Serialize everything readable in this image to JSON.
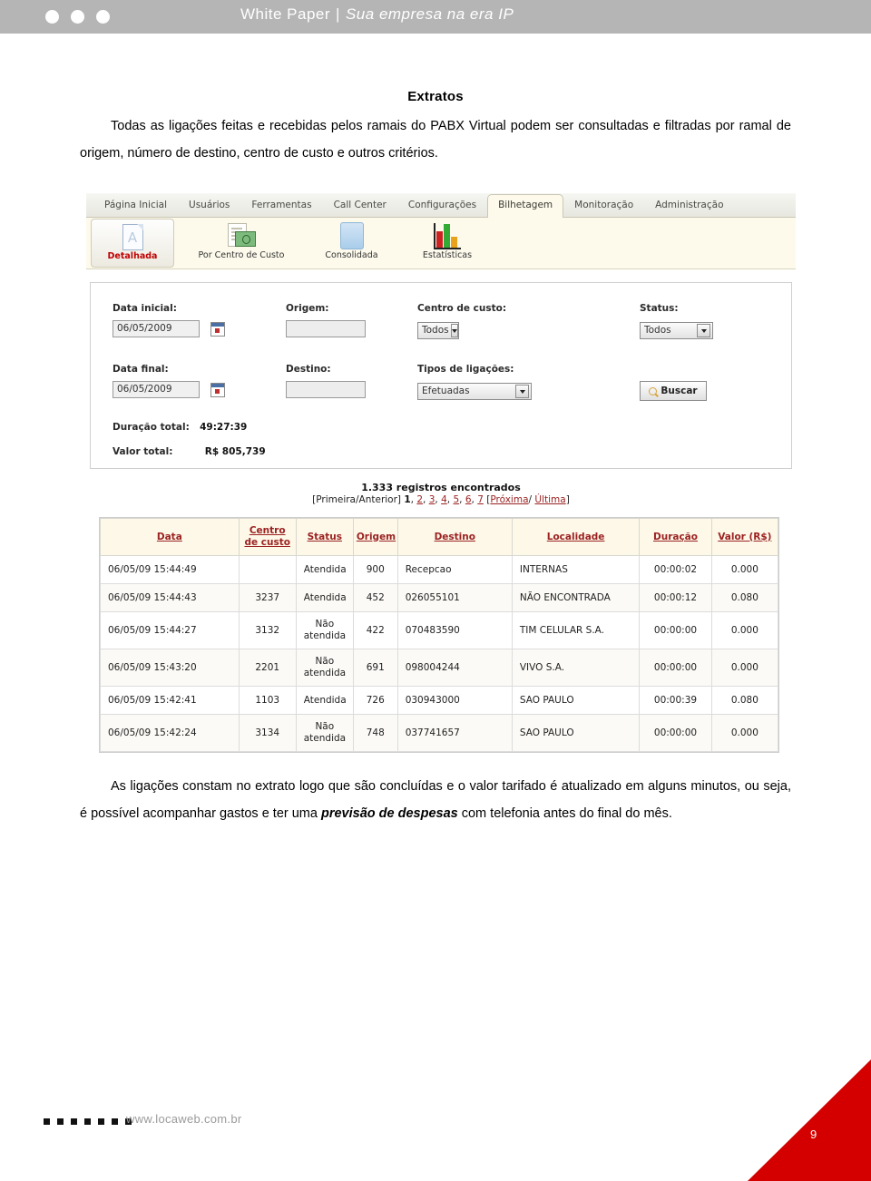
{
  "banner": {
    "dots": 3,
    "title_main": "White Paper",
    "separator": "|",
    "title_italic": "Sua empresa na era IP",
    "bg_color": "#b5b5b5"
  },
  "document": {
    "heading": "Extratos",
    "intro_paragraph": "Todas as ligações feitas e recebidas pelos ramais do PABX Virtual podem ser consultadas e filtradas por ramal de origem, número de destino, centro de custo e outros critérios.",
    "closing_paragraph_part1": "As ligações constam no extrato logo que são concluídas e o valor tarifado é atualizado em alguns minutos, ou seja, é possível acompanhar gastos e ter uma ",
    "closing_paragraph_bold": "previsão de despesas",
    "closing_paragraph_part2": " com telefonia antes do final do mês."
  },
  "app": {
    "tabs": [
      {
        "label": "Página Inicial",
        "active": false
      },
      {
        "label": "Usuários",
        "active": false
      },
      {
        "label": "Ferramentas",
        "active": false
      },
      {
        "label": "Call Center",
        "active": false
      },
      {
        "label": "Configurações",
        "active": false
      },
      {
        "label": "Bilhetagem",
        "active": true
      },
      {
        "label": "Monitoração",
        "active": false
      },
      {
        "label": "Administração",
        "active": false
      }
    ],
    "toolbar": [
      {
        "label": "Detalhada",
        "icon": "document-page-icon",
        "selected": true
      },
      {
        "label": "Por Centro de Custo",
        "icon": "cost-center-icon",
        "selected": false
      },
      {
        "label": "Consolidada",
        "icon": "consolidated-sheet-icon",
        "selected": false
      },
      {
        "label": "Estatísticas",
        "icon": "bar-chart-icon",
        "selected": false
      }
    ],
    "filters": {
      "data_inicial_label": "Data inicial:",
      "data_inicial_value": "06/05/2009",
      "data_final_label": "Data final:",
      "data_final_value": "06/05/2009",
      "origem_label": "Origem:",
      "origem_value": "",
      "destino_label": "Destino:",
      "destino_value": "",
      "centro_custo_label": "Centro de custo:",
      "centro_custo_value": "Todos",
      "tipos_ligacoes_label": "Tipos de ligações:",
      "tipos_ligacoes_value": "Efetuadas",
      "status_label": "Status:",
      "status_value": "Todos",
      "buscar_label": "Buscar"
    },
    "totals": {
      "duracao_label": "Duração total:",
      "duracao_value": "49:27:39",
      "valor_label": "Valor total:",
      "valor_value": "R$ 805,739"
    },
    "results": {
      "count_text": "1.333 registros encontrados",
      "pager_first": "[Primeira/Anterior]",
      "pages": [
        "1",
        "2",
        "3",
        "4",
        "5",
        "6",
        "7"
      ],
      "current_page": "1",
      "pager_open_bracket": "[",
      "pager_next": "Próxima",
      "pager_slash": "/",
      "pager_last": "Última",
      "pager_close_bracket": "]"
    },
    "table": {
      "columns": [
        "Data",
        "Centro de custo",
        "Status",
        "Origem",
        "Destino",
        "Localidade",
        "Duração",
        "Valor (R$)"
      ],
      "rows": [
        {
          "data": "06/05/09 15:44:49",
          "centro_custo": "",
          "status": "Atendida",
          "origem": "900",
          "destino": "Recepcao",
          "localidade": "INTERNAS",
          "duracao": "00:00:02",
          "valor": "0.000"
        },
        {
          "data": "06/05/09 15:44:43",
          "centro_custo": "3237",
          "status": "Atendida",
          "origem": "452",
          "destino": "026055101",
          "localidade": "NÃO ENCONTRADA",
          "duracao": "00:00:12",
          "valor": "0.080"
        },
        {
          "data": "06/05/09 15:44:27",
          "centro_custo": "3132",
          "status": "Não atendida",
          "origem": "422",
          "destino": "070483590",
          "localidade": "TIM CELULAR S.A.",
          "duracao": "00:00:00",
          "valor": "0.000"
        },
        {
          "data": "06/05/09 15:43:20",
          "centro_custo": "2201",
          "status": "Não atendida",
          "origem": "691",
          "destino": "098004244",
          "localidade": "VIVO S.A.",
          "duracao": "00:00:00",
          "valor": "0.000"
        },
        {
          "data": "06/05/09 15:42:41",
          "centro_custo": "1103",
          "status": "Atendida",
          "origem": "726",
          "destino": "030943000",
          "localidade": "SAO PAULO",
          "duracao": "00:00:39",
          "valor": "0.080"
        },
        {
          "data": "06/05/09 15:42:24",
          "centro_custo": "3134",
          "status": "Não atendida",
          "origem": "748",
          "destino": "037741657",
          "localidade": "SAO PAULO",
          "duracao": "00:00:00",
          "valor": "0.000"
        }
      ]
    }
  },
  "footer": {
    "squares": 7,
    "url": "www.locaweb.com.br",
    "page_number": "9",
    "accent_color": "#d40000"
  }
}
